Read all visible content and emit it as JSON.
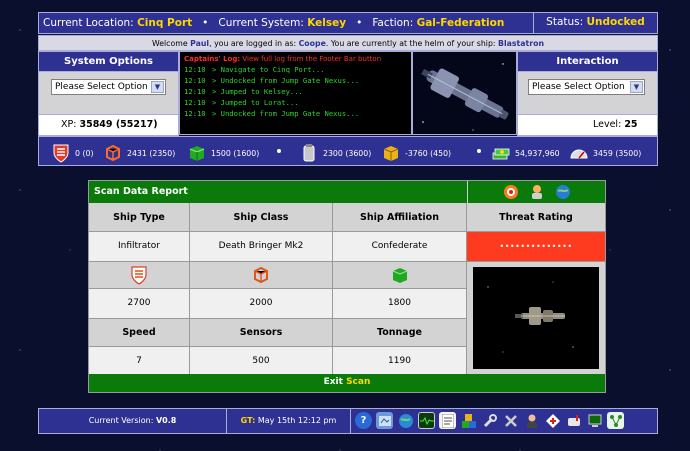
{
  "header": {
    "location_label": "Current Location:",
    "location": "Cinq Port",
    "system_label": "Current System:",
    "system": "Kelsey",
    "faction_label": "Faction:",
    "faction": "Gal-Federation",
    "status_label": "Status:",
    "status": "Undocked"
  },
  "welcome": {
    "prefix": "Welcome",
    "user": "Paul",
    "mid1": ", you are logged in as:",
    "login": "Coope",
    "mid2": ". You are currently at the helm of your ship:",
    "ship": "Blastatron"
  },
  "system_options": {
    "title": "System Options",
    "select": "Please Select Option",
    "xp_label": "XP:",
    "xp": "35849 (55217)"
  },
  "interaction": {
    "title": "Interaction",
    "select": "Please Select Option",
    "level_label": "Level:",
    "level": "25"
  },
  "captains_log": {
    "title": "Captains' Log:",
    "subtitle": "View full log from the Footer Bar button",
    "entries": [
      {
        "time": "12:10",
        "text": "> Navigate to Cinq Port..."
      },
      {
        "time": "12:10",
        "text": "> Undocked from Jump Gate Nexus..."
      },
      {
        "time": "12:10",
        "text": "> Jumped to Kelsey..."
      },
      {
        "time": "12:10",
        "text": "> Jumped to Lorat..."
      },
      {
        "time": "12:10",
        "text": "> Undocked from Jump Gate Nexus..."
      }
    ]
  },
  "resources": {
    "shields": "0 (0)",
    "structure": "2431 (2350)",
    "cargo": "1500 (1600)",
    "fuel": "2300 (3600)",
    "crates": "-3760 (450)",
    "credits": "54,937,960",
    "speed": "3459 (3500)"
  },
  "scan": {
    "title": "Scan Data Report",
    "headers": [
      "Ship Type",
      "Ship Class",
      "Ship Affiliation",
      "Threat Rating"
    ],
    "values": [
      "Infiltrator",
      "Death Bringer Mk2",
      "Confederate",
      "••••••••••••••"
    ],
    "stat_values": [
      "2700",
      "2000",
      "1800"
    ],
    "headers2": [
      "Speed",
      "Sensors",
      "Tonnage"
    ],
    "values2": [
      "7",
      "500",
      "1190"
    ],
    "exit_label": "Exit",
    "exit_highlight": "Scan"
  },
  "footer": {
    "version_label": "Current Version:",
    "version": "V0.8",
    "gt_label": "GT:",
    "gt": "May 15th 12:12 pm"
  },
  "colors": {
    "panel_blue": "#2e3191",
    "accent_yellow": "#ffd800",
    "scan_green": "#0a7b0a",
    "threat_red": "#ff3b1f"
  },
  "icons": [
    "help-icon",
    "map-icon",
    "globe-icon",
    "monitor-icon",
    "notes-icon",
    "cubes-icon",
    "wrench-icon",
    "tools-icon",
    "pilot-icon",
    "medic-icon",
    "mailbox-icon",
    "computer-icon",
    "network-icon"
  ]
}
